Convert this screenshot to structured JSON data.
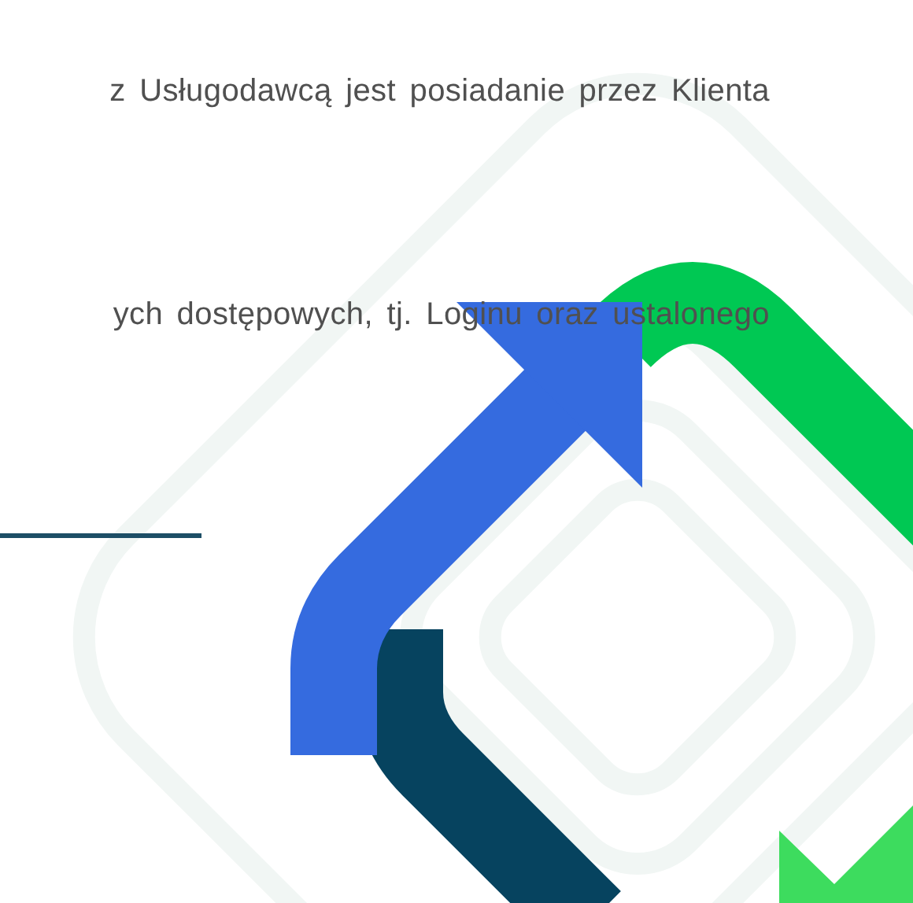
{
  "paragraphs": [
    {
      "text": "z Usługodawcą jest posiadanie przez Klienta"
    },
    {
      "text": "ych dostępowych, tj. Loginu oraz ustalonego"
    }
  ]
}
